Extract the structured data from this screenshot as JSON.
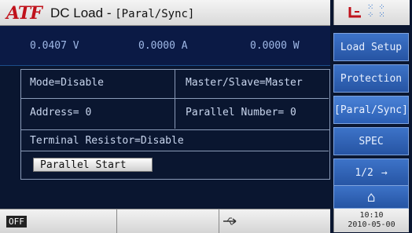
{
  "header": {
    "logo": "ATF",
    "title": "DC Load -",
    "subtitle": "[Paral/Sync]"
  },
  "measurements": {
    "voltage": "0.0407 V",
    "current": "0.0000 A",
    "power": "0.0000 W"
  },
  "settings": {
    "mode": "Mode=Disable",
    "master_slave": "Master/Slave=Master",
    "address": "Address=  0",
    "parallel_number": "Parallel Number=  0",
    "terminal_resistor": "Terminal Resistor=Disable",
    "start_button": "Parallel Start"
  },
  "sidebar": {
    "items": [
      {
        "label": "Load Setup"
      },
      {
        "label": "Protection"
      },
      {
        "label": "[Paral/Sync]"
      },
      {
        "label": "SPEC"
      },
      {
        "label": "1/2",
        "arrow": "→"
      },
      {
        "label": "⌂",
        "icon": "home-icon"
      }
    ]
  },
  "status": {
    "output": "OFF",
    "time": "10:10",
    "date": "2010-05-00",
    "usb_icon": "usb-icon"
  },
  "colors": {
    "background": "#0a1630",
    "sidebar_button": "#2f62b3",
    "text": "#c9d6ee",
    "logo": "#c0121b"
  }
}
